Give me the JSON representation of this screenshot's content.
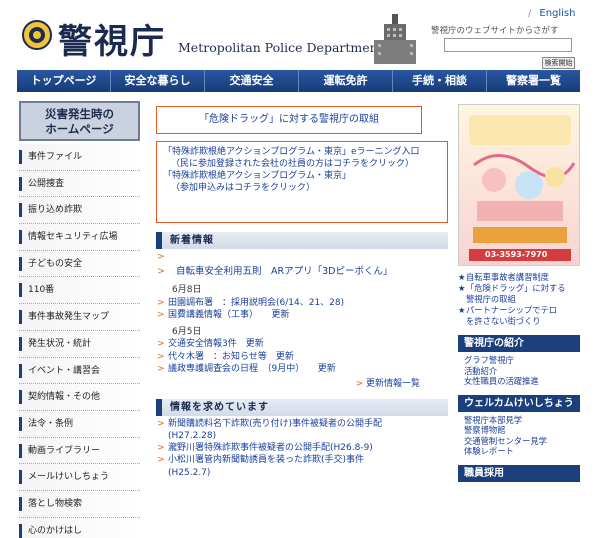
{
  "header": {
    "logo_ja": "警視庁",
    "logo_en": "Metropolitan Police Department",
    "lang_link": "English",
    "search_label": "警視庁のウェブサイトからさがす",
    "search_button": "検索開始"
  },
  "nav": [
    "トップページ",
    "安全な暮らし",
    "交通安全",
    "運転免許",
    "手続・相談",
    "警察署一覧"
  ],
  "sidebar": {
    "banner_line1": "災害発生時の",
    "banner_line2": "ホームページ",
    "items": [
      "事件ファイル",
      "公開捜査",
      "振り込め詐欺",
      "情報セキュリティ広場",
      "子どもの安全",
      "110番",
      "事件事故発生マップ",
      "発生状況・統計",
      "イベント・講習会",
      "契約情報・その他",
      "法令・条例",
      "動画ライブラリー",
      "メールけいしちょう",
      "落とし物検索",
      "心のかけはし"
    ]
  },
  "center": {
    "danger_link": "「危険ドラッグ」に対する警視庁の取組",
    "program": {
      "line1": "「特殊詐欺根絶アクションプログラム・東京」eラーニング入口",
      "line2": "（民に参加登録された会社の社員の方はコチラをクリック）",
      "line3": "「特殊詐欺根絶アクションプログラム・東京」",
      "line4": "（参加申込みはコチラをクリック）"
    },
    "news_title": "新着情報",
    "news_lead": "自転車安全利用五則　ARアプリ「3Dピーポくん」",
    "date1": "6月8日",
    "news_group1": [
      "田園調布署　：採用説明会(6/14、21、28)",
      "国費講義情報（工事）　　更新"
    ],
    "date2": "6月5日",
    "news_group2": [
      "交通安全情報3件　更新",
      "代々木署　：お知らせ等　更新",
      "議政専護調査会の日程　（9月中）　　更新"
    ],
    "more": "更新情報一覧",
    "info_title": "情報を求めています",
    "info_items": [
      {
        "text": "新聞購読料名下詐欺(売り付け)事件被疑者の公開手配",
        "cont": "(H27.2.28)"
      },
      {
        "text": "瀧野川署特殊詐欺事件被疑者の公開手配(H26.8-9)",
        "cont": ""
      },
      {
        "text": "小松川署管内新聞勧誘員を装った詐欺(手交)事件",
        "cont": "(H25.2.7)"
      }
    ]
  },
  "right": {
    "poster_phone": "03-3593-7970",
    "links": [
      {
        "text": "自転車事故者講習制度",
        "cont": ""
      },
      {
        "text": "「危険ドラッグ」に対する",
        "cont": "警視庁の取組"
      },
      {
        "text": "パートナーシップでテロ",
        "cont": "を許さない街づくり"
      }
    ],
    "intro_title": "警視庁の紹介",
    "intro_items": [
      "グラフ警視庁",
      "活動紹介",
      "女性職員の活躍推進"
    ],
    "welcome_title": "ウェルカムけいしちょう",
    "welcome_items": [
      "警視庁本部見学",
      "警察博物館",
      "交通管制センター見学",
      "体験レポート"
    ],
    "recruit_title": "職員採用"
  },
  "colors": {
    "navy": "#1a3f7a",
    "accent_orange": "#e05a2b",
    "link_blue": "#1a3f9a"
  }
}
